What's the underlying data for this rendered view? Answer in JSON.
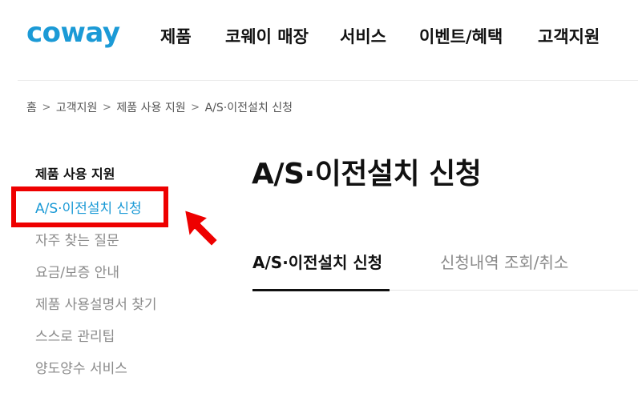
{
  "header": {
    "logo_text": "coway",
    "nav": [
      "제품",
      "코웨이 매장",
      "서비스",
      "이벤트/혜택",
      "고객지원"
    ]
  },
  "breadcrumb": {
    "items": [
      "홈",
      "고객지원",
      "제품 사용 지원",
      "A/S·이전설치 신청"
    ],
    "separator": ">"
  },
  "sidebar": {
    "title": "제품 사용 지원",
    "items": [
      "A/S·이전설치 신청",
      "자주 찾는 질문",
      "요금/보증 안내",
      "제품 사용설명서 찾기",
      "스스로 관리팁",
      "양도양수 서비스"
    ],
    "active_index": 0
  },
  "main": {
    "title": "A/S·이전설치 신청",
    "tabs": [
      "A/S·이전설치 신청",
      "신청내역 조회/취소"
    ],
    "active_tab": 0
  },
  "colors": {
    "brand": "#1b9ad6",
    "highlight_box": "#ee0000",
    "text_dark": "#111111",
    "text_muted": "#8a8a8a"
  },
  "annotations": {
    "highlight_icon": "red-rectangle",
    "arrow_icon": "red-arrow-pointing-up-left"
  }
}
